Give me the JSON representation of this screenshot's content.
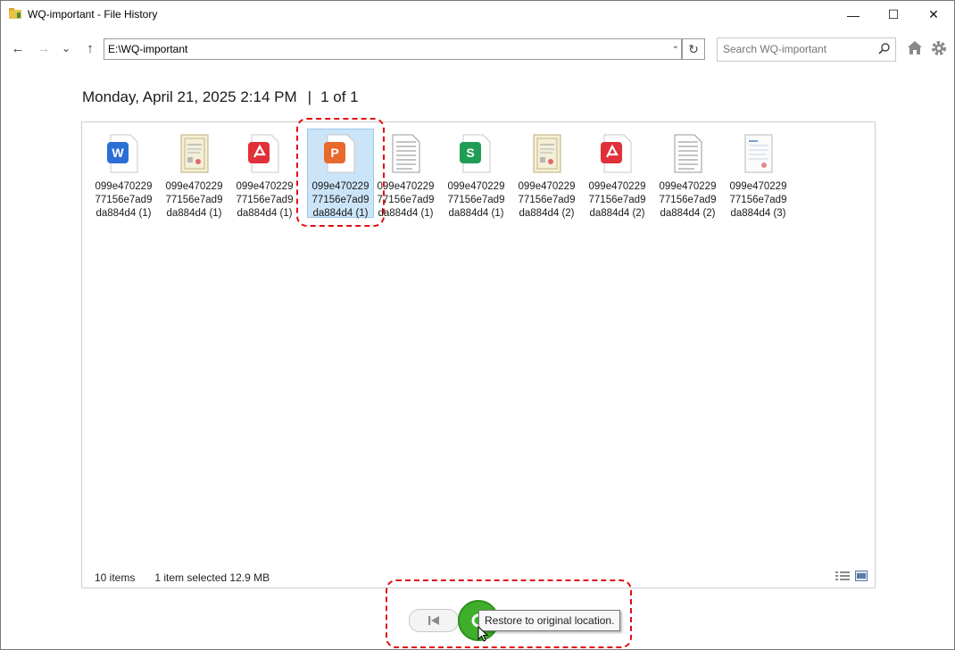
{
  "window": {
    "title": "WQ-important - File History",
    "minimize_glyph": "—",
    "maximize_glyph": "☐",
    "close_glyph": "✕"
  },
  "nav": {
    "back_glyph": "←",
    "forward_glyph": "→",
    "recent_glyph": "⌄",
    "up_glyph": "↑",
    "address": "E:\\WQ-important",
    "address_dropdown_glyph": "⌄",
    "refresh_glyph": "↻",
    "search_placeholder": "Search WQ-important"
  },
  "heading": {
    "date": "Monday, April 21, 2025 2:14 PM",
    "separator": "|",
    "position": "1 of 1"
  },
  "files": [
    {
      "name": "099e470229\n77156e7ad9\nda884d4 (1)",
      "icon": "word-doc-icon",
      "selected": false
    },
    {
      "name": "099e470229\n77156e7ad9\nda884d4 (1)",
      "icon": "certificate-image-icon",
      "selected": false
    },
    {
      "name": "099e470229\n77156e7ad9\nda884d4 (1)",
      "icon": "pdf-file-icon",
      "selected": false
    },
    {
      "name": "099e470229\n77156e7ad9\nda884d4 (1)",
      "icon": "powerpoint-file-icon",
      "selected": true
    },
    {
      "name": "099e470229\n77156e7ad9\nda884d4 (1)",
      "icon": "text-file-icon",
      "selected": false
    },
    {
      "name": "099e470229\n77156e7ad9\nda884d4 (1)",
      "icon": "spreadsheet-file-icon",
      "selected": false
    },
    {
      "name": "099e470229\n77156e7ad9\nda884d4 (2)",
      "icon": "certificate-image-icon",
      "selected": false
    },
    {
      "name": "099e470229\n77156e7ad9\nda884d4 (2)",
      "icon": "pdf-file-icon",
      "selected": false
    },
    {
      "name": "099e470229\n77156e7ad9\nda884d4 (2)",
      "icon": "text-file-icon",
      "selected": false
    },
    {
      "name": "099e470229\n77156e7ad9\nda884d4 (3)",
      "icon": "document-image-icon",
      "selected": false
    }
  ],
  "status": {
    "items": "10 items",
    "selection": "1 item selected  12.9 MB"
  },
  "controls": {
    "tooltip": "Restore to original location."
  },
  "colors": {
    "selection_bg": "#cce4f7",
    "highlight_red": "#e01010",
    "restore_green": "#3fae2a",
    "word_blue": "#2b6fd6",
    "pdf_red": "#e0303a",
    "ppt_orange": "#e8692c",
    "sheet_green": "#1f9d55"
  }
}
